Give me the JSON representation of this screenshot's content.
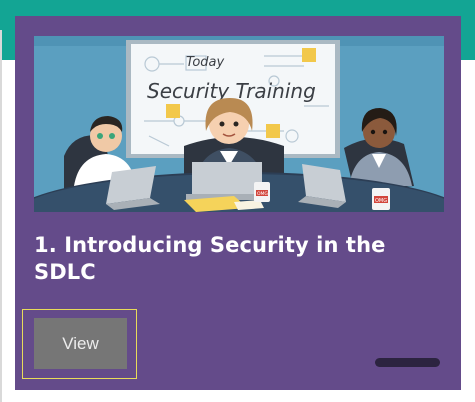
{
  "hero": {
    "whiteboard_line1": "Today",
    "whiteboard_line2": "Security Training",
    "mug_label": "OMG"
  },
  "card": {
    "title": "1. Introducing Security in the SDLC",
    "view_label": "View"
  },
  "colors": {
    "header_teal": "#13a594",
    "card_purple": "#644b8a",
    "button_gray": "#767676",
    "focus_ring": "#e8dc5a"
  }
}
